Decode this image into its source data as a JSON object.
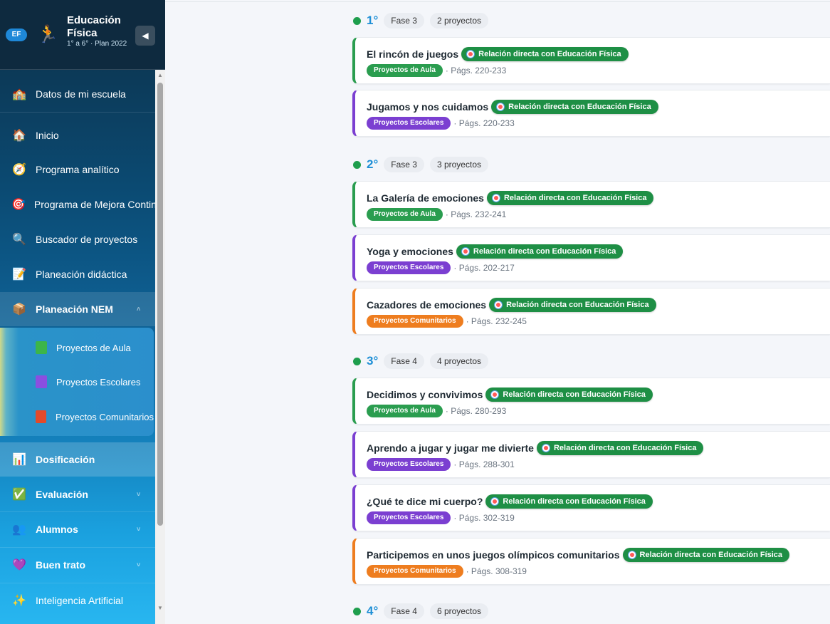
{
  "sidebar": {
    "badge": "EF",
    "title": "Educación Física",
    "subtitle": "1° a 6° · Plan 2022",
    "collapse": "◀",
    "items": [
      {
        "label": "Datos de mi escuela",
        "icon": "🏫"
      },
      {
        "label": "Inicio",
        "icon": "🏠"
      },
      {
        "label": "Programa analítico",
        "icon": "🧭"
      },
      {
        "label": "Programa de Mejora Continua",
        "icon": "🎯"
      },
      {
        "label": "Buscador de proyectos",
        "icon": "🔍"
      },
      {
        "label": "Planeación didáctica",
        "icon": "📝"
      },
      {
        "label": "Planeación NEM",
        "icon": "📦"
      },
      {
        "label": "Dosificación",
        "icon": "📊"
      },
      {
        "label": "Evaluación",
        "icon": "✅"
      },
      {
        "label": "Alumnos",
        "icon": "👥"
      },
      {
        "label": "Buen trato",
        "icon": "💜"
      },
      {
        "label": "Inteligencia Artificial",
        "icon": "✨"
      }
    ],
    "submenu": [
      {
        "label": "Proyectos de Aula",
        "color": "#3cb54a"
      },
      {
        "label": "Proyectos Escolares",
        "color": "#8a4fe0"
      },
      {
        "label": "Proyectos Comunitarios",
        "color": "#e34a2a"
      }
    ]
  },
  "relation_label": "Relación directa con Educación Física",
  "grades": [
    {
      "grade": "1°",
      "phase": "Fase 3",
      "count": "2 proyectos"
    },
    {
      "grade": "2°",
      "phase": "Fase 3",
      "count": "3 proyectos"
    },
    {
      "grade": "3°",
      "phase": "Fase 4",
      "count": "4 proyectos"
    },
    {
      "grade": "4°",
      "phase": "Fase 4",
      "count": "6 proyectos"
    }
  ],
  "projects": [
    {
      "title": "El rincón de juegos",
      "type": "Proyectos de Aula",
      "pages": "· Págs. 220-233"
    },
    {
      "title": "Jugamos y nos cuidamos",
      "type": "Proyectos Escolares",
      "pages": "· Págs. 220-233"
    },
    {
      "title": "La Galería de emociones",
      "type": "Proyectos de Aula",
      "pages": "· Págs. 232-241"
    },
    {
      "title": "Yoga y emociones",
      "type": "Proyectos Escolares",
      "pages": "· Págs. 202-217"
    },
    {
      "title": "Cazadores de emociones",
      "type": "Proyectos Comunitarios",
      "pages": "· Págs. 232-245"
    },
    {
      "title": "Decidimos y convivimos",
      "type": "Proyectos de Aula",
      "pages": "· Págs. 280-293"
    },
    {
      "title": "Aprendo a jugar y jugar me divierte",
      "type": "Proyectos Escolares",
      "pages": "· Págs. 288-301"
    },
    {
      "title": "¿Qué te dice mi cuerpo?",
      "type": "Proyectos Escolares",
      "pages": "· Págs. 302-319"
    },
    {
      "title": "Participemos en unos juegos olímpicos comunitarios",
      "type": "Proyectos Comunitarios",
      "pages": "· Págs. 308-319"
    }
  ],
  "colors": {
    "aula": "#2a9d4f",
    "escolar": "#7b3fd1",
    "comunitario": "#ee7d1f",
    "accent": "#1e8fd6"
  }
}
